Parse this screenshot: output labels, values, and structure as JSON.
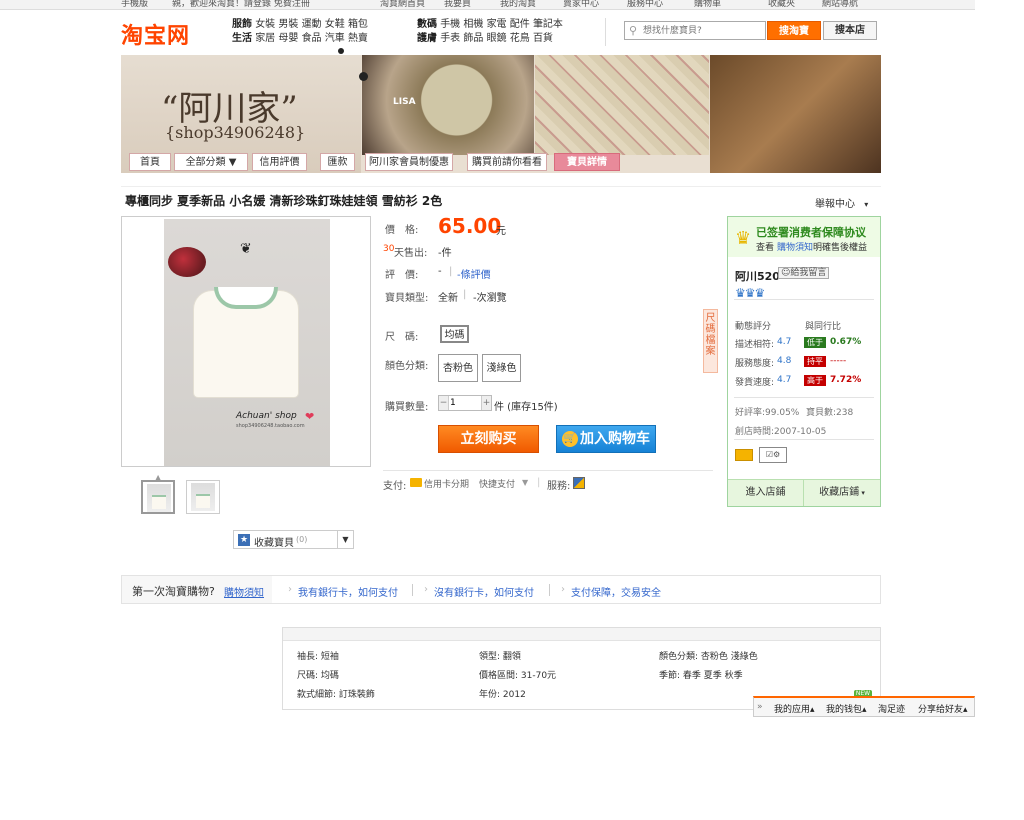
{
  "topbar": {
    "mobile": "手機版",
    "welcome": "親，歡迎來淘寶！請登錄 免費注冊",
    "links": [
      "淘寶網首頁",
      "我要買",
      "我的淘寶",
      "賣家中心",
      "服務中心",
      "購物車",
      "收藏夾",
      "網站導航"
    ]
  },
  "header": {
    "logo": "淘宝网",
    "categories": [
      [
        "服飾",
        "女裝",
        "男裝",
        "運動",
        "女鞋",
        "箱包"
      ],
      [
        "生活",
        "家居",
        "母嬰",
        "食品",
        "汽車",
        "熱賣"
      ],
      [
        "數碼",
        "手機",
        "相機",
        "家電",
        "配件",
        "筆記本"
      ],
      [
        "護膚",
        "手表",
        "飾品",
        "眼鏡",
        "花鳥",
        "百貨"
      ]
    ],
    "search_placeholder": "想找什麼寶貝?",
    "search_taobao": "搜淘寶",
    "search_store": "搜本店"
  },
  "banner": {
    "shop_name": "“阿川家”",
    "shop_id": "{shop34906248}",
    "brand_tag": "LISA"
  },
  "shopnav": {
    "tabs": [
      "首頁",
      "全部分類 ▼",
      "信用評價",
      "匯款",
      "阿川家會員制優惠",
      "購買前請你看看",
      "寶貝詳情"
    ]
  },
  "product": {
    "title": "專櫃同步 夏季新品 小名媛 清新珍珠釘珠娃娃領 雪紡衫 2色",
    "report": "舉報中心",
    "watermark": "Achuan' shop",
    "watermark_url": "shop34906248.taobao.com",
    "price_label": "價　格:",
    "price": "65.00",
    "price_unit": "元",
    "sold_prefix": "30",
    "sold_label": "天售出:",
    "sold_value": "-件",
    "review_label": "評　價:",
    "review_value": "-",
    "review_link": "-條評價",
    "type_label": "寶貝類型:",
    "type_value": "全新",
    "type_extra": "-次瀏覽",
    "size_label": "尺　碼:",
    "size_option": "均碼",
    "color_label": "顏色分類:",
    "color_options": [
      "杏粉色",
      "淺綠色"
    ],
    "qty_label": "購買數量:",
    "qty_value": "1",
    "qty_stock": "件 (庫存15件)",
    "buy_now": "立刻购买",
    "add_cart": "加入购物车",
    "side_tab": "尺碼檔案",
    "pay_label": "支付:",
    "pay_credit": "信用卡分期",
    "pay_quick": "快捷支付",
    "service_label": "服務:",
    "fav_label": "收藏寶貝",
    "fav_count": "(0)"
  },
  "seller": {
    "guarantee": "已签署消费者保障协议",
    "guarantee_sub": "查看",
    "guarantee_link": "購物須知",
    "guarantee_sub2": "明確售後權益",
    "name": "阿川520",
    "message": "給我留言",
    "rating_title": "動態評分",
    "rating_compare": "與同行比",
    "rows": [
      {
        "label": "描述相符:",
        "score": "4.7",
        "badge": "低于",
        "pct": "0.67%",
        "color": "#2a7a1f"
      },
      {
        "label": "服務態度:",
        "score": "4.8",
        "badge": "持平",
        "pct": "-----",
        "color": "#c40000"
      },
      {
        "label": "發貨速度:",
        "score": "4.7",
        "badge": "高于",
        "pct": "7.72%",
        "color": "#c40000"
      }
    ],
    "good_rate": "好評率:99.05%",
    "item_count": "寶貝數:238",
    "open_date": "創店時間:2007-10-05",
    "enter_store": "進入店鋪",
    "fav_store": "收藏店鋪"
  },
  "firstbar": {
    "question": "第一次淘寶購物?",
    "guide": "購物須知",
    "items": [
      "我有銀行卡，如何支付",
      "沒有銀行卡，如何支付",
      "支付保障，交易安全"
    ]
  },
  "attrs": [
    "袖長: 短袖",
    "領型: 翻領",
    "顏色分類: 杏粉色 淺綠色",
    "尺碼: 均碼",
    "價格區間: 31-70元",
    "季節: 春季 夏季 秋季",
    "款式細節: 訂珠裝飾",
    "年份: 2012"
  ],
  "toolbar": {
    "new": "NEW",
    "items": [
      "我的应用",
      "我的钱包",
      "淘足迹",
      "分享给好友"
    ]
  },
  "colors": {
    "accent": "#ff4400",
    "buy": "#f05a00",
    "cart": "#1682d6",
    "seller_border": "#9fd49f"
  }
}
